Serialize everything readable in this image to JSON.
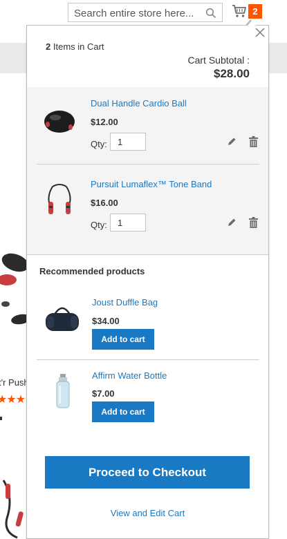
{
  "header": {
    "search": {
      "placeholder": "Search entire store here...",
      "icon": "search-icon"
    },
    "cart": {
      "icon": "cart-icon",
      "count": "2",
      "badge_color": "#ff5501"
    }
  },
  "background": {
    "product_name_fragment": "t'r Push",
    "rating_stars_filled": 3,
    "rating_stars_total": 4
  },
  "minicart": {
    "close_icon": "close-icon",
    "items_count": "2",
    "items_label": "Items in Cart",
    "subtotal_label": "Cart Subtotal :",
    "subtotal_amount": "$28.00",
    "items": [
      {
        "name": "Dual Handle Cardio Ball",
        "price": "$12.00",
        "qty_label": "Qty:",
        "qty": "1",
        "thumb": "cardio-ball-thumbnail"
      },
      {
        "name": "Pursuit Lumaflex™ Tone Band",
        "price": "$16.00",
        "qty_label": "Qty:",
        "qty": "1",
        "thumb": "tone-band-thumbnail"
      }
    ],
    "recommended": {
      "heading": "Recommended products",
      "products": [
        {
          "name": "Joust Duffle Bag",
          "price": "$34.00",
          "button": "Add to cart",
          "thumb": "duffle-bag-thumbnail"
        },
        {
          "name": "Affirm Water Bottle",
          "price": "$7.00",
          "button": "Add to cart",
          "thumb": "water-bottle-thumbnail"
        }
      ]
    },
    "checkout_label": "Proceed to Checkout",
    "view_edit_label": "View and Edit Cart"
  },
  "colors": {
    "link": "#1979c3",
    "button": "#1979c3",
    "accent": "#ff5501"
  }
}
